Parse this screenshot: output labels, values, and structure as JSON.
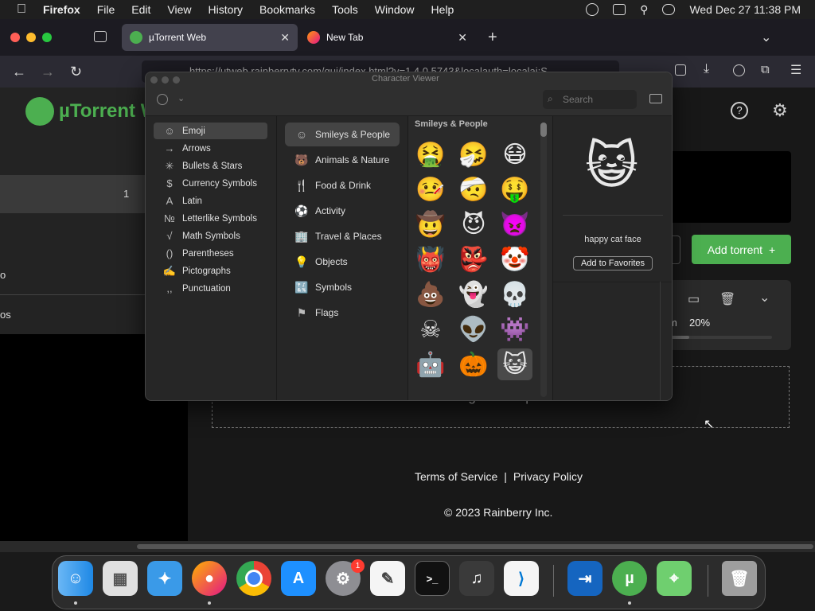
{
  "menubar": {
    "app": "Firefox",
    "items": [
      "File",
      "Edit",
      "View",
      "History",
      "Bookmarks",
      "Tools",
      "Window",
      "Help"
    ],
    "datetime": "Wed Dec 27  11:38 PM"
  },
  "tabs": [
    {
      "title": "µTorrent Web",
      "active": true
    },
    {
      "title": "New Tab",
      "active": false
    }
  ],
  "urlbar": {
    "value": "https://utweb.rainberrytv.com/gui/index.html?v=1.4.0.5743&localauth=localai:S..."
  },
  "page": {
    "logo_text": "µTorrent W",
    "download_count": "1",
    "left_frag_1": "o",
    "left_frag_2": "os",
    "add_torrent_label": "Add torrent",
    "progress_text": "20%",
    "progress_prefix": "m",
    "progress": 0.2,
    "drop_text": "Drag and drop a file.",
    "footer_links": [
      "Terms of Service",
      "Privacy Policy"
    ],
    "copyright": "© 2023 Rainberry Inc."
  },
  "character_viewer": {
    "title": "Character Viewer",
    "search_placeholder": "Search",
    "categories": [
      {
        "label": "Emoji",
        "icon": "☺"
      },
      {
        "label": "Arrows",
        "icon": "→"
      },
      {
        "label": "Bullets & Stars",
        "icon": "✳"
      },
      {
        "label": "Currency Symbols",
        "icon": "$"
      },
      {
        "label": "Latin",
        "icon": "A"
      },
      {
        "label": "Letterlike Symbols",
        "icon": "№"
      },
      {
        "label": "Math Symbols",
        "icon": "√"
      },
      {
        "label": "Parentheses",
        "icon": "()"
      },
      {
        "label": "Pictographs",
        "icon": "✍"
      },
      {
        "label": "Punctuation",
        "icon": ",,"
      }
    ],
    "subcategories": [
      {
        "label": "Smileys & People",
        "icon": "☺"
      },
      {
        "label": "Animals & Nature",
        "icon": "🐻"
      },
      {
        "label": "Food & Drink",
        "icon": "🍴"
      },
      {
        "label": "Activity",
        "icon": "⚽"
      },
      {
        "label": "Travel & Places",
        "icon": "🏢"
      },
      {
        "label": "Objects",
        "icon": "💡"
      },
      {
        "label": "Symbols",
        "icon": "🔣"
      },
      {
        "label": "Flags",
        "icon": "⚑"
      }
    ],
    "grid_header": "Smileys & People",
    "emojis": [
      [
        "🤮",
        "🤧",
        "😷"
      ],
      [
        "🤒",
        "🤕",
        "🤑"
      ],
      [
        "🤠",
        "😈",
        "👿"
      ],
      [
        "👹",
        "👺",
        "🤡"
      ],
      [
        "💩",
        "👻",
        "💀"
      ],
      [
        "☠",
        "👽",
        "👾"
      ],
      [
        "🤖",
        "🎃",
        "😺"
      ]
    ],
    "selected_emoji": "😺",
    "selected_name": "happy cat face",
    "favorites_button": "Add to Favorites"
  },
  "dock": {
    "apps": [
      "Finder",
      "Launchpad",
      "Safari",
      "Firefox",
      "Chrome",
      "App Store",
      "System Settings",
      "TextEdit",
      "Terminal",
      "GarageBand",
      "VS Code",
      "Migration",
      "µTorrent",
      "Maps",
      "Trash"
    ],
    "settings_badge": "1"
  },
  "colors": {
    "accent_green": "#4caf50",
    "firefox_tab_active": "#42414d"
  }
}
